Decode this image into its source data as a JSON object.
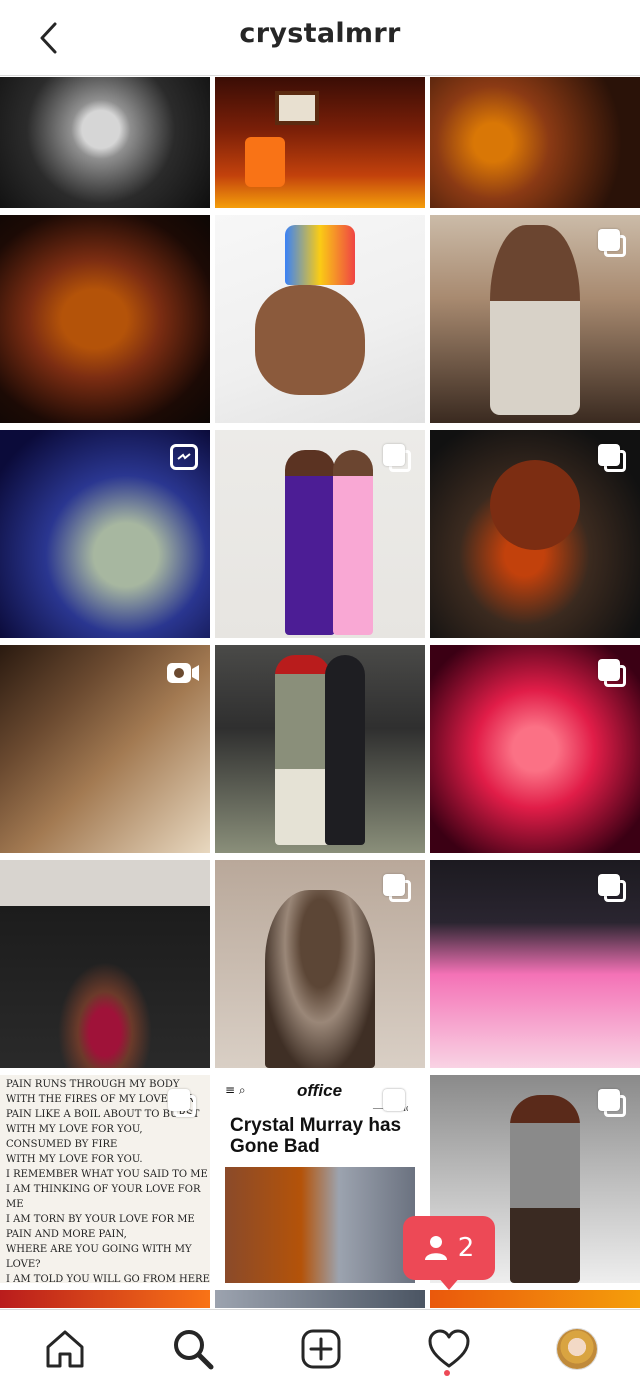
{
  "header": {
    "title": "crystalmrr",
    "back_icon": "chevron-left-icon"
  },
  "grid": {
    "posts": [
      {
        "id": 1,
        "kind": "photo",
        "palette": [
          "#1a1a1a",
          "#9a9a9a",
          "#d6d6d6"
        ]
      },
      {
        "id": 2,
        "kind": "photo",
        "palette": [
          "#3a0d05",
          "#c2410c",
          "#f59e0b"
        ]
      },
      {
        "id": 3,
        "kind": "photo",
        "palette": [
          "#2a1208",
          "#8b3a14",
          "#d97706"
        ]
      },
      {
        "id": 4,
        "kind": "photo",
        "palette": [
          "#0d0705",
          "#7c2d12",
          "#ea580c"
        ]
      },
      {
        "id": 5,
        "kind": "photo",
        "palette": [
          "#f3f3f3",
          "#e5b79a",
          "#3b82f6"
        ]
      },
      {
        "id": 6,
        "kind": "carousel",
        "palette": [
          "#1e1b18",
          "#d6c8b8",
          "#7a5a45"
        ]
      },
      {
        "id": 7,
        "kind": "igtv",
        "palette": [
          "#0b0b3a",
          "#1e2a8a",
          "#a7b7a0"
        ]
      },
      {
        "id": 8,
        "kind": "carousel",
        "palette": [
          "#ecebe8",
          "#4c1d95",
          "#f9a8d4"
        ]
      },
      {
        "id": 9,
        "kind": "carousel",
        "palette": [
          "#111111",
          "#3b2a1f",
          "#c2410c"
        ]
      },
      {
        "id": 10,
        "kind": "video",
        "palette": [
          "#a37a52",
          "#e8d8c0",
          "#2a1a10"
        ]
      },
      {
        "id": 11,
        "kind": "photo",
        "palette": [
          "#2f2f2f",
          "#8a8f7a",
          "#b91c1c"
        ]
      },
      {
        "id": 12,
        "kind": "carousel",
        "palette": [
          "#3b0014",
          "#e11d48",
          "#fb7185"
        ]
      },
      {
        "id": 13,
        "kind": "photo",
        "palette": [
          "#1c1c1c",
          "#d8d4cf",
          "#9f1239"
        ]
      },
      {
        "id": 14,
        "kind": "carousel",
        "palette": [
          "#b9a89a",
          "#5c4636",
          "#d9cfc5"
        ]
      },
      {
        "id": 15,
        "kind": "carousel",
        "palette": [
          "#1c1a20",
          "#f472b6",
          "#f9d3e4"
        ]
      },
      {
        "id": 16,
        "kind": "carousel",
        "palette": [
          "#f5f2ec",
          "#f5f2ec",
          "#e7e2d8"
        ]
      },
      {
        "id": 17,
        "kind": "carousel",
        "palette": [
          "#ffffff",
          "#ffffff",
          "#b45309"
        ]
      },
      {
        "id": 18,
        "kind": "carousel",
        "palette": [
          "#8a8a8a",
          "#eeeeee",
          "#5a4a3f"
        ]
      }
    ]
  },
  "handwritten_note": {
    "text": "PAIN RUNS THROUGH MY BODY\nWITH THE FIRES OF MY LOVE FOR\nPAIN LIKE A BOIL ABOUT TO BURST\nWITH MY LOVE FOR YOU,\nCONSUMED BY FIRE\nWITH MY LOVE FOR YOU.\nI REMEMBER WHAT YOU SAID TO ME\nI AM THINKING OF YOUR LOVE FOR ME\nI AM TORN BY YOUR LOVE FOR ME\nPAIN AND MORE PAIN,\nWHERE ARE YOU GOING WITH MY LOVE?\nI AM TOLD YOU WILL GO FROM HERE\nI AM TOLD YOU WILL LEAVE ME HERE\nMY BODY IS NUMB WITH GRIEF\nREMEMBER WHAT I SAID MY LOVE"
  },
  "magazine": {
    "logo": "office",
    "menu_glyphs": "≡ ⌕",
    "section": "— Music",
    "headline": "Crystal Murray has Gone Bad"
  },
  "notification": {
    "icon": "person-icon",
    "count": "2"
  },
  "bottom_nav": {
    "items": [
      {
        "name": "home",
        "icon": "home-icon"
      },
      {
        "name": "search",
        "icon": "search-icon",
        "active": true
      },
      {
        "name": "create",
        "icon": "plus-square-icon"
      },
      {
        "name": "activity",
        "icon": "heart-icon"
      },
      {
        "name": "profile",
        "icon": "avatar"
      }
    ],
    "accent": "#ed4956"
  }
}
